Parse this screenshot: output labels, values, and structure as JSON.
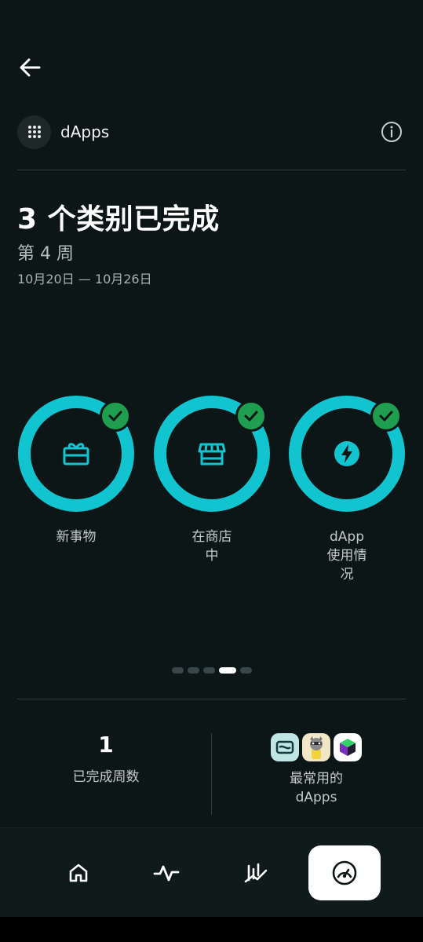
{
  "header": {
    "back_icon": "arrow-left-icon",
    "app_icon": "grid-dots-icon",
    "title": "dApps",
    "info_icon": "info-icon"
  },
  "summary": {
    "headline": "3 个类别已完成",
    "week": "第 4 周",
    "date_range": "10月20日 — 10月26日"
  },
  "categories": [
    {
      "label": "新事物",
      "icon": "gift-icon",
      "completed": true
    },
    {
      "label": "在商店\n中",
      "icon": "storefront-icon",
      "completed": true
    },
    {
      "label": "dApp\n使用情\n况",
      "icon": "bolt-icon",
      "completed": true
    }
  ],
  "pager": {
    "count": 5,
    "active_index": 3
  },
  "stats": {
    "completed_weeks_value": "1",
    "completed_weeks_label": "已完成周数",
    "top_dapps_label": "最常用的\ndApps",
    "top_dapps_icons": [
      "card-app-icon",
      "raccoon-app-icon",
      "cube-app-icon"
    ]
  },
  "nav": {
    "items": [
      {
        "icon": "home-icon",
        "active": false
      },
      {
        "icon": "activity-icon",
        "active": false
      },
      {
        "icon": "chart-trend-icon",
        "active": false
      },
      {
        "icon": "gauge-icon",
        "active": true
      }
    ]
  },
  "colors": {
    "background": "#0c1616",
    "ring": "#12c4d0",
    "check": "#1e9e4e",
    "nav_active": "#ffffff"
  }
}
